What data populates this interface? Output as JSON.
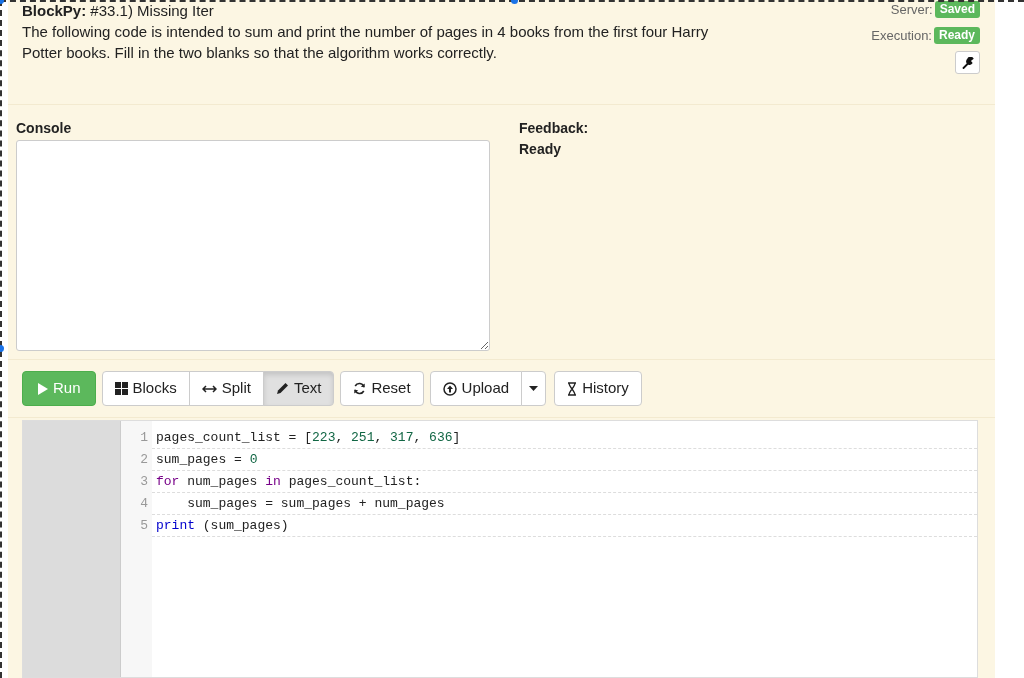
{
  "header": {
    "title": "**BlockPy:** #33.1) Missing Iter",
    "instructions": "The following code is intended to sum and print the number of pages in 4 books from the first four Harry Potter books. Fill in the two blanks so that the algorithm works correctly."
  },
  "status": [
    {
      "label": "Server:",
      "badge": "Saved"
    },
    {
      "label": "Execution:",
      "badge": "Ready"
    }
  ],
  "console": {
    "label": "Console"
  },
  "feedback": {
    "label": "Feedback:",
    "message": "Ready"
  },
  "toolbar": {
    "run": "Run",
    "views": [
      {
        "label": "Blocks",
        "selected": false
      },
      {
        "label": "Split",
        "selected": false
      },
      {
        "label": "Text",
        "selected": true
      }
    ],
    "reset": "Reset",
    "upload": "Upload",
    "history": "History"
  },
  "editor": {
    "lines": [
      {
        "number": "1",
        "tokens": [
          {
            "kind": "plain",
            "text": "pages_count_list = ["
          },
          {
            "kind": "number",
            "text": "223"
          },
          {
            "kind": "plain",
            "text": ", "
          },
          {
            "kind": "number",
            "text": "251"
          },
          {
            "kind": "plain",
            "text": ", "
          },
          {
            "kind": "number",
            "text": "317"
          },
          {
            "kind": "plain",
            "text": ", "
          },
          {
            "kind": "number",
            "text": "636"
          },
          {
            "kind": "plain",
            "text": "]"
          }
        ]
      },
      {
        "number": "2",
        "tokens": [
          {
            "kind": "plain",
            "text": "sum_pages = "
          },
          {
            "kind": "number",
            "text": "0"
          }
        ]
      },
      {
        "number": "3",
        "tokens": [
          {
            "kind": "keyword",
            "text": "for"
          },
          {
            "kind": "plain",
            "text": " num_pages "
          },
          {
            "kind": "keyword",
            "text": "in"
          },
          {
            "kind": "plain",
            "text": " pages_count_list:"
          }
        ]
      },
      {
        "number": "4",
        "tokens": [
          {
            "kind": "plain",
            "text": "    sum_pages = sum_pages + num_pages"
          }
        ]
      },
      {
        "number": "5",
        "tokens": [
          {
            "kind": "builtin",
            "text": "print"
          },
          {
            "kind": "plain",
            "text": " (sum_pages)"
          }
        ]
      }
    ]
  }
}
